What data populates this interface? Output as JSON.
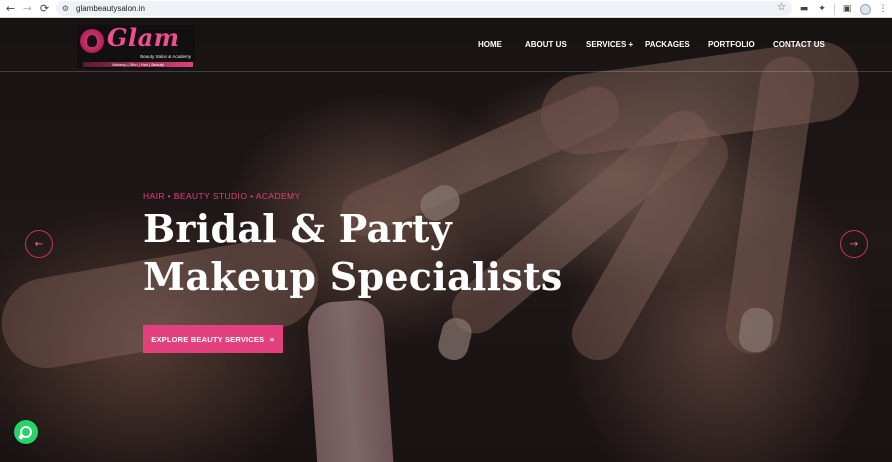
{
  "browser": {
    "url": "glambeautysalon.in",
    "back_icon": "←",
    "forward_icon": "→",
    "reload_icon": "⟳",
    "star_icon": "☆"
  },
  "header": {
    "logo": {
      "text": "Glam",
      "subtitle": "Beauty Salon & Academy",
      "bar": "Makeup | Skin | Hair | Beauty"
    },
    "menu": [
      {
        "label": "HOME"
      },
      {
        "label": "ABOUT US"
      },
      {
        "label": "SERVICES +"
      },
      {
        "label": "PACKAGES"
      },
      {
        "label": "PORTFOLIO"
      },
      {
        "label": "CONTACT US"
      }
    ]
  },
  "hero": {
    "tagline": "HAIR • BEAUTY STUDIO • ACADEMY",
    "headline_line1": "Bridal & Party",
    "headline_line2": "Makeup Specialists",
    "cta_label": "EXPLORE BEAUTY SERVICES",
    "cta_icon": "»",
    "prev_icon": "←",
    "next_icon": "→"
  },
  "colors": {
    "accent": "#e3417e",
    "background": "#1a1616"
  }
}
